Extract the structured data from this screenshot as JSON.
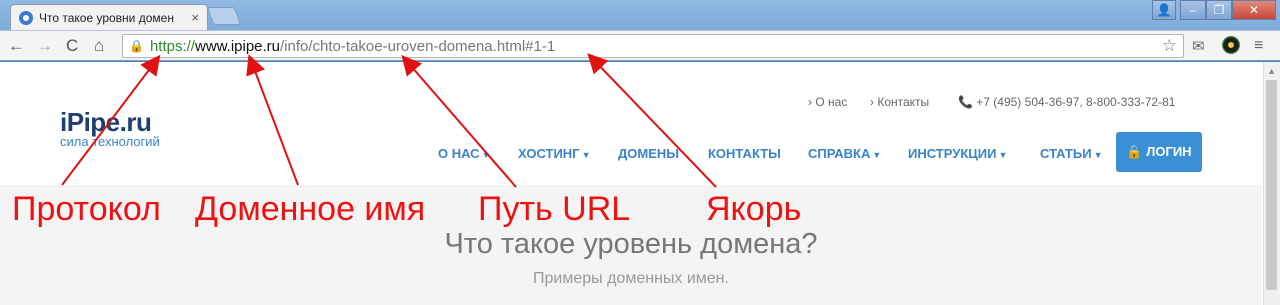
{
  "tab": {
    "title": "Что такое уровни домен",
    "close": "×"
  },
  "url": {
    "protocol": "https://",
    "domain": "www.ipipe.ru",
    "path": "/info/chto-takoe-uroven-domena.html",
    "anchor": "#1-1"
  },
  "toolbar": {
    "back": "←",
    "forward": "→",
    "reload": "C",
    "home": "⌂",
    "star": "☆",
    "menu": "≡"
  },
  "site": {
    "logo": "iPipe.ru",
    "tagline": "сила технологий",
    "top_links": [
      "› О нас",
      "› Контакты"
    ],
    "phone": "📞 +7 (495) 504-36-97, 8-800-333-72-81",
    "nav": [
      "О НАС",
      "ХОСТИНГ",
      "ДОМЕНЫ",
      "КОНТАКТЫ",
      "СПРАВКА",
      "ИНСТРУКЦИИ",
      "СТАТЬИ"
    ],
    "login": "🔒 ЛОГИН",
    "hero_title": "Что такое уровень домена?",
    "hero_sub": "Примеры доменных имен."
  },
  "annotations": [
    "Протокол",
    "Доменное имя",
    "Путь URL",
    "Якорь"
  ],
  "colors": {
    "annotation": "#e11111",
    "accent": "#3b83c8",
    "protocol": "#2f8a2f"
  },
  "icons": [
    "lock-icon",
    "star-icon",
    "menu-icon",
    "user-icon"
  ]
}
